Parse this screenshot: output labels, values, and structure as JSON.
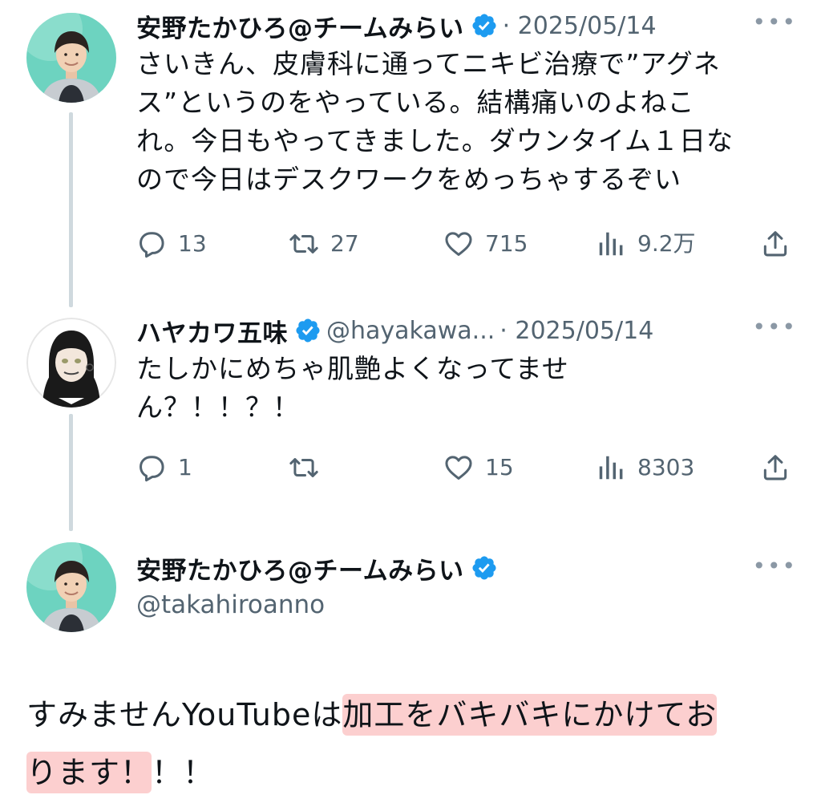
{
  "tweets": [
    {
      "name": "安野たかひろ@チームみらい",
      "meta": "· 2025/05/14",
      "text_lines": [
        "さいきん、皮膚科に通ってニキビ治療で”アグネ",
        "ス”というのをやっている。結構痛いのよねこ",
        "れ。今日もやってきました。ダウンタイム１日な",
        "ので今日はデスクワークをめっちゃするぞい"
      ],
      "more": "•••",
      "replies": "13",
      "retweets": "27",
      "likes": "715",
      "views": "9.2万"
    },
    {
      "name": "ハヤカワ五味",
      "handle": "@hayakawa...",
      "meta": "· 2025/05/14",
      "text_lines": [
        "たしかにめちゃ肌艶よくなってませ",
        "ん？！！？！"
      ],
      "more": "•••",
      "replies": "1",
      "likes": "15",
      "views": "8303"
    }
  ],
  "main": {
    "name": "安野たかひろ@チームみらい",
    "handle": "@takahiroanno",
    "more": "•••",
    "text_1": "すみませんYouTubeは",
    "text_hl1": "加工をバキバキにかけてお",
    "text_hl2": "ります！",
    "text_2": "！！"
  },
  "colors": {
    "accent": "#1d9bf0",
    "secondary_text": "#536471",
    "thread_line": "#cfd9de",
    "highlight": "#f7a8a8"
  },
  "icons": [
    "verified-badge-icon",
    "reply-icon",
    "retweet-icon",
    "like-icon",
    "views-icon",
    "share-icon",
    "more-icon"
  ]
}
